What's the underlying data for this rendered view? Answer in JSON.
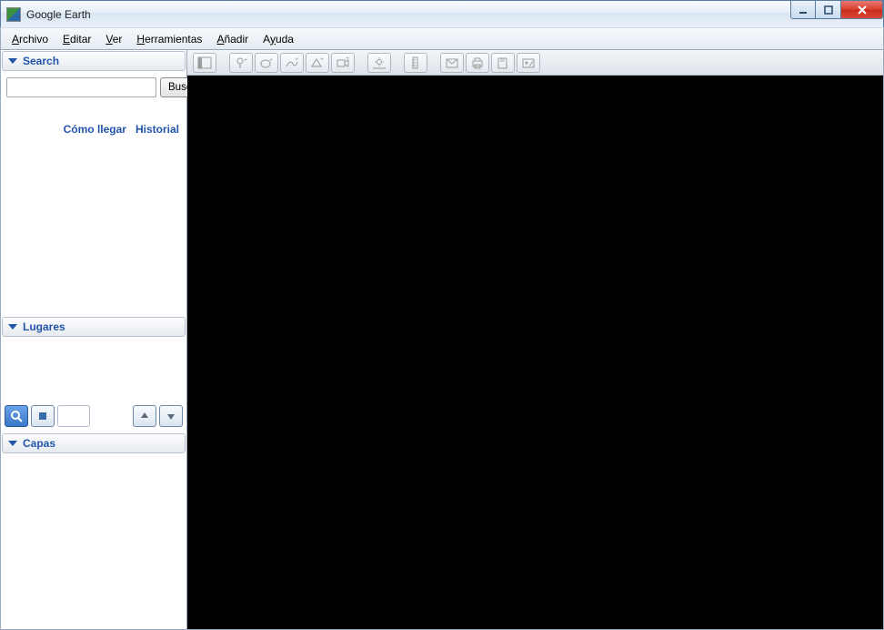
{
  "window": {
    "title": "Google Earth"
  },
  "menu": {
    "items": [
      {
        "pre": "",
        "u": "A",
        "post": "rchivo"
      },
      {
        "pre": "",
        "u": "E",
        "post": "ditar"
      },
      {
        "pre": "",
        "u": "V",
        "post": "er"
      },
      {
        "pre": "",
        "u": "H",
        "post": "erramientas"
      },
      {
        "pre": "",
        "u": "A",
        "post": "ñadir"
      },
      {
        "pre": "A",
        "u": "y",
        "post": "uda"
      }
    ]
  },
  "sidebar": {
    "search": {
      "header": "Search",
      "input_value": "",
      "button": "Buscar",
      "link_directions": "Cómo llegar",
      "link_history": "Historial"
    },
    "places": {
      "header": "Lugares"
    },
    "layers": {
      "header": "Capas"
    }
  },
  "toolbar": {
    "buttons": [
      "toggle-sidebar",
      "pushpin",
      "polygon",
      "path",
      "image-overlay",
      "record-tour",
      "sunlight",
      "ruler",
      "email",
      "print",
      "save-image",
      "view-in-maps"
    ]
  }
}
